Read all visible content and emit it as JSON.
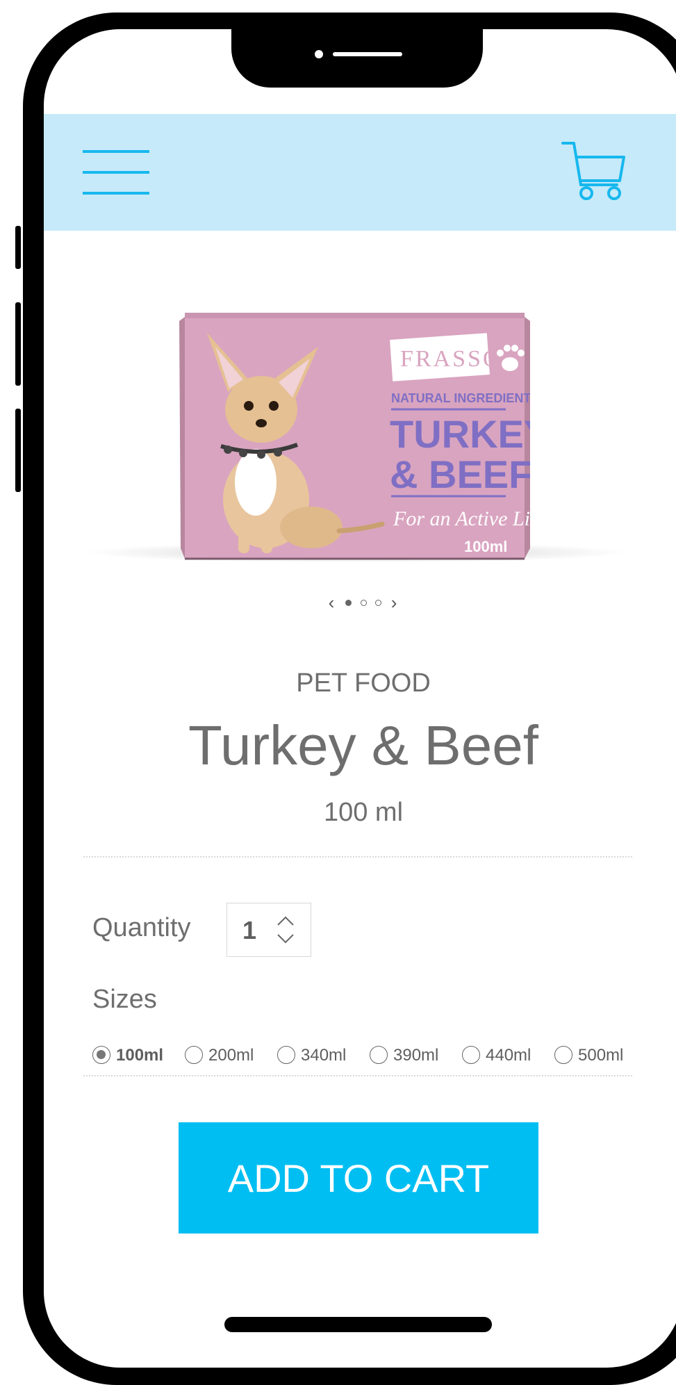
{
  "header": {
    "menu_icon": "hamburger-icon",
    "cart_icon": "shopping-cart-icon",
    "background": "#c6eafa",
    "accent": "#17b8ee"
  },
  "product": {
    "image": {
      "brand": "FRASSO",
      "tagline": "NATURAL INGREDIENTS",
      "flavor_line1": "TURKEY",
      "flavor_line2": "& BEEF",
      "slogan": "For an Active Life",
      "volume": "100ml",
      "box_color": "#d9a4c0",
      "text_color": "#7f6fc4"
    },
    "carousel": {
      "prev": "‹",
      "next": "›",
      "slide_count": 3,
      "active_index": 0
    },
    "category": "PET FOOD",
    "title": "Turkey & Beef",
    "volume": "100 ml"
  },
  "quantity": {
    "label": "Quantity",
    "value": "1"
  },
  "sizes": {
    "label": "Sizes",
    "options": [
      "100ml",
      "200ml",
      "340ml",
      "390ml",
      "440ml",
      "500ml"
    ],
    "selected": "100ml"
  },
  "cta": {
    "label": "ADD TO CART",
    "color": "#00bef2"
  }
}
